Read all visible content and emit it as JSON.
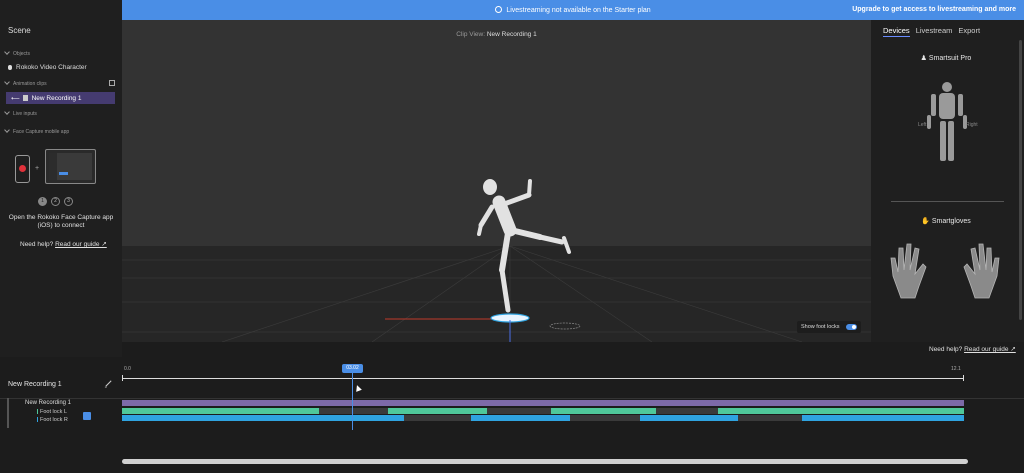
{
  "banner": {
    "message": "Livestreaming not available on the Starter plan",
    "cta": "Upgrade to get access to livestreaming and more",
    "color": "#4a8ee6"
  },
  "scene": {
    "title": "Scene",
    "objects_header": "Objects",
    "objects": [
      "Rokoko Video Character"
    ],
    "clips_header": "Animation clips",
    "clips": [
      "New Recording 1"
    ],
    "live_header": "Live inputs",
    "face_header": "Face Capture mobile app",
    "steps": [
      "1",
      "2",
      "3"
    ],
    "open_text": "Open the Rokoko Face Capture app (iOS) to connect",
    "help_prefix": "Need help?",
    "help_link": "Read our guide ↗"
  },
  "viewport": {
    "clip_view_prefix": "Clip View:",
    "clip_view_name": "New Recording 1",
    "foot_locks_label": "Show foot locks"
  },
  "right": {
    "tabs": [
      "Devices",
      "Livestream",
      "Export"
    ],
    "active_tab": "Devices",
    "suit_title": "Smartsuit Pro",
    "left_label": "Left",
    "right_label": "Right",
    "gloves_title": "Smartgloves",
    "help_prefix": "Need help?",
    "help_link": "Read our guide ↗"
  },
  "timeline": {
    "recording_name": "New Recording 1",
    "start": "0.0",
    "end": "12.1",
    "playhead": "03.02",
    "track_name": "New Recording 1",
    "foot_lock_l": "Foot lock L",
    "foot_lock_r": "Foot lock R"
  },
  "colors": {
    "accent": "#4a8ee6",
    "selection": "#453b70",
    "track_purple": "#7d6aa8",
    "foot_lock_l": "#4fc89a",
    "foot_lock_r": "#2fa3e0",
    "rec": "#e0313a"
  }
}
